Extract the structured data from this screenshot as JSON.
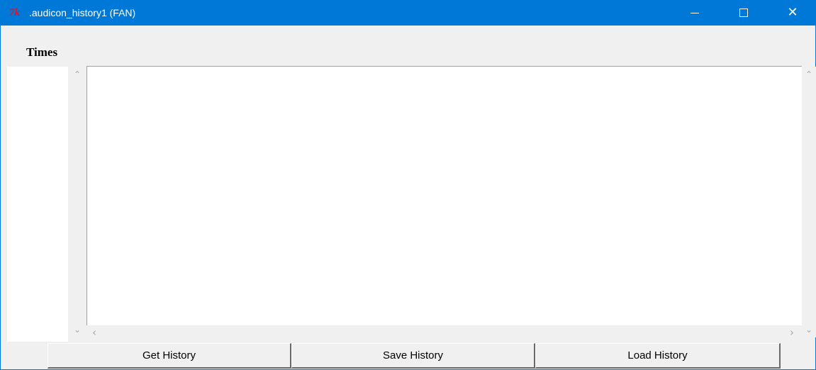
{
  "window": {
    "title": ".audicon_history1 (FAN)",
    "app_icon_text": "7k",
    "accent_color": "#0078d7",
    "controls": {
      "minimize_icon": "minimize-icon",
      "maximize_icon": "maximize-icon",
      "close_icon": "close-icon",
      "close_glyph": "✕"
    }
  },
  "times": {
    "label": "Times",
    "items": []
  },
  "history_text": "",
  "scrollbars": {
    "up_glyph": "⌃",
    "down_glyph": "⌄",
    "left_glyph": "‹",
    "right_glyph": "›"
  },
  "buttons": {
    "get_history": "Get History",
    "save_history": "Save History",
    "load_history": "Load History"
  }
}
